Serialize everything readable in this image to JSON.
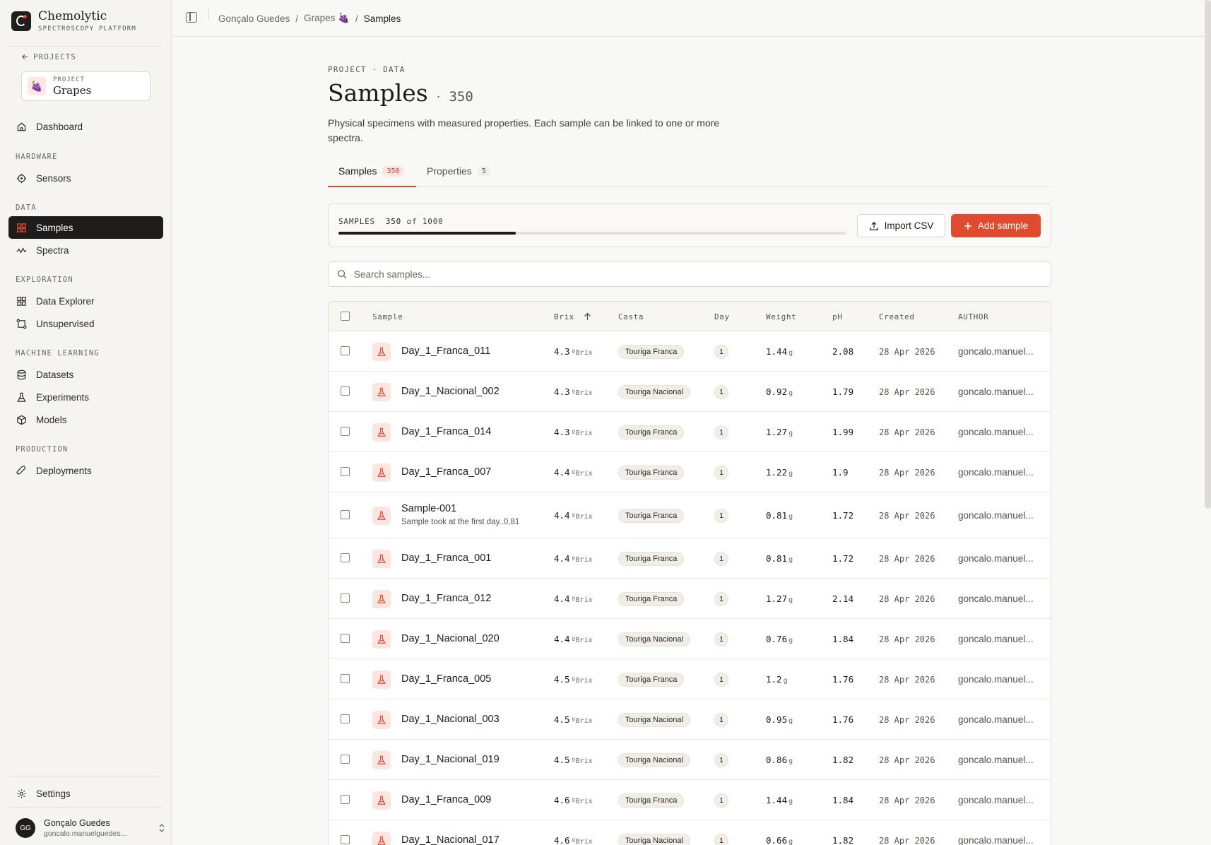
{
  "brand": {
    "name": "Chemolytic",
    "subtitle": "SPECTROSCOPY PLATFORM"
  },
  "sidebar": {
    "back_label": "PROJECTS",
    "project": {
      "label": "PROJECT",
      "name": "Grapes",
      "emoji": "🍇"
    },
    "dashboard": "Dashboard",
    "sections": {
      "hardware": "HARDWARE",
      "data": "DATA",
      "exploration": "EXPLORATION",
      "ml": "MACHINE LEARNING",
      "production": "PRODUCTION"
    },
    "items": {
      "sensors": "Sensors",
      "samples": "Samples",
      "spectra": "Spectra",
      "data_explorer": "Data Explorer",
      "unsupervised": "Unsupervised",
      "datasets": "Datasets",
      "experiments": "Experiments",
      "models": "Models",
      "deployments": "Deployments"
    },
    "settings": "Settings",
    "user": {
      "initials": "GG",
      "name": "Gonçalo Guedes",
      "email": "goncalo.manuelguedes..."
    }
  },
  "breadcrumb": {
    "owner": "Gonçalo Guedes",
    "project": "Grapes 🍇",
    "current": "Samples",
    "sep": "/"
  },
  "page": {
    "eyebrow": "PROJECT · DATA",
    "title": "Samples",
    "title_sep": "·",
    "count": "350",
    "description": "Physical specimens with measured properties. Each sample can be linked to one or more spectra."
  },
  "tabs": [
    {
      "label": "Samples",
      "badge": "350"
    },
    {
      "label": "Properties",
      "badge": "5"
    }
  ],
  "quota": {
    "label": "SAMPLES",
    "used": "350",
    "of": "of",
    "limit": "1000",
    "fraction": 0.35
  },
  "actions": {
    "import": "Import CSV",
    "add": "Add sample"
  },
  "search": {
    "placeholder": "Search samples..."
  },
  "table": {
    "columns": {
      "sample": "Sample",
      "brix": "Brix",
      "casta": "Casta",
      "day": "Day",
      "weight": "Weight",
      "ph": "pH",
      "created": "Created",
      "author": "AUTHOR"
    },
    "brix_unit": "ºBrix",
    "weight_unit": "g",
    "rows": [
      {
        "name": "Day_1_Franca_011",
        "brix": "4.3",
        "casta": "Touriga Franca",
        "day": "1",
        "weight": "1.44",
        "ph": "2.08",
        "created": "28 Apr 2026",
        "author": "goncalo.manuel..."
      },
      {
        "name": "Day_1_Nacional_002",
        "brix": "4.3",
        "casta": "Touriga Nacional",
        "day": "1",
        "weight": "0.92",
        "ph": "1.79",
        "created": "28 Apr 2026",
        "author": "goncalo.manuel..."
      },
      {
        "name": "Day_1_Franca_014",
        "brix": "4.3",
        "casta": "Touriga Franca",
        "day": "1",
        "weight": "1.27",
        "ph": "1.99",
        "created": "28 Apr 2026",
        "author": "goncalo.manuel..."
      },
      {
        "name": "Day_1_Franca_007",
        "brix": "4.4",
        "casta": "Touriga Franca",
        "day": "1",
        "weight": "1.22",
        "ph": "1.9",
        "created": "28 Apr 2026",
        "author": "goncalo.manuel..."
      },
      {
        "name": "Sample-001",
        "note": "Sample took at the first day..0,81",
        "brix": "4.4",
        "casta": "Touriga Franca",
        "day": "1",
        "weight": "0.81",
        "ph": "1.72",
        "created": "28 Apr 2026",
        "author": "goncalo.manuel..."
      },
      {
        "name": "Day_1_Franca_001",
        "brix": "4.4",
        "casta": "Touriga Franca",
        "day": "1",
        "weight": "0.81",
        "ph": "1.72",
        "created": "28 Apr 2026",
        "author": "goncalo.manuel..."
      },
      {
        "name": "Day_1_Franca_012",
        "brix": "4.4",
        "casta": "Touriga Franca",
        "day": "1",
        "weight": "1.27",
        "ph": "2.14",
        "created": "28 Apr 2026",
        "author": "goncalo.manuel..."
      },
      {
        "name": "Day_1_Nacional_020",
        "brix": "4.4",
        "casta": "Touriga Nacional",
        "day": "1",
        "weight": "0.76",
        "ph": "1.84",
        "created": "28 Apr 2026",
        "author": "goncalo.manuel..."
      },
      {
        "name": "Day_1_Franca_005",
        "brix": "4.5",
        "casta": "Touriga Franca",
        "day": "1",
        "weight": "1.2",
        "ph": "1.76",
        "created": "28 Apr 2026",
        "author": "goncalo.manuel..."
      },
      {
        "name": "Day_1_Nacional_003",
        "brix": "4.5",
        "casta": "Touriga Nacional",
        "day": "1",
        "weight": "0.95",
        "ph": "1.76",
        "created": "28 Apr 2026",
        "author": "goncalo.manuel..."
      },
      {
        "name": "Day_1_Nacional_019",
        "brix": "4.5",
        "casta": "Touriga Nacional",
        "day": "1",
        "weight": "0.86",
        "ph": "1.82",
        "created": "28 Apr 2026",
        "author": "goncalo.manuel..."
      },
      {
        "name": "Day_1_Franca_009",
        "brix": "4.6",
        "casta": "Touriga Franca",
        "day": "1",
        "weight": "1.44",
        "ph": "1.84",
        "created": "28 Apr 2026",
        "author": "goncalo.manuel..."
      },
      {
        "name": "Day_1_Nacional_017",
        "brix": "4.6",
        "casta": "Touriga Nacional",
        "day": "1",
        "weight": "0.66",
        "ph": "1.82",
        "created": "28 Apr 2026",
        "author": "goncalo.manuel..."
      }
    ]
  },
  "colors": {
    "accent": "#e04b30",
    "dark": "#1e1d1b",
    "background": "#f8f8f6"
  }
}
